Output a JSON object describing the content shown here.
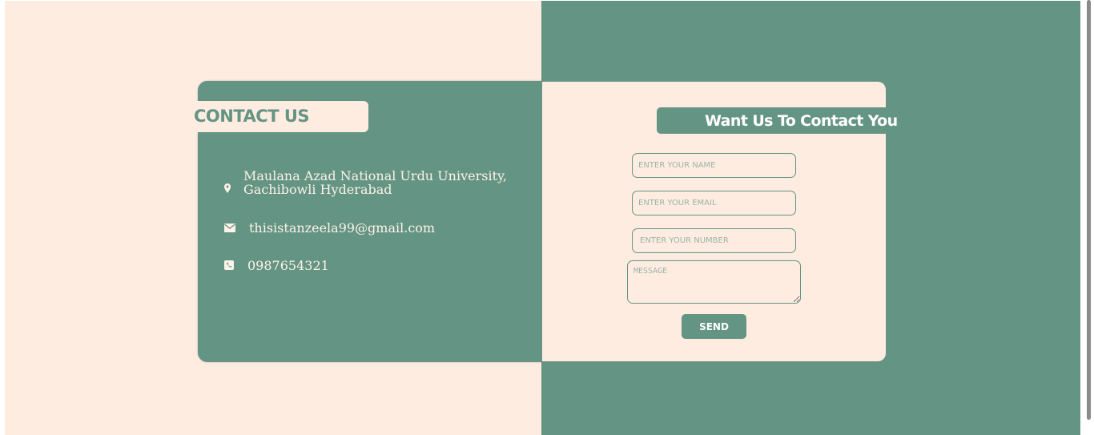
{
  "contact": {
    "title": "CONTACT US",
    "address_line1": "Maulana Azad National Urdu University,",
    "address_line2": "Gachibowli Hyderabad",
    "email": "thisistanzeela99@gmail.com",
    "phone": "0987654321"
  },
  "form": {
    "title": "Want Us To Contact You",
    "name_placeholder": "ENTER YOUR NAME",
    "email_placeholder": "ENTER YOUR EMAIL",
    "number_placeholder": "ENTER YOUR NUMBER",
    "message_placeholder": "MESSAGE",
    "send_label": "SEND"
  },
  "icons": {
    "address": "map-marker-icon",
    "email": "envelope-icon",
    "phone": "phone-square-icon"
  },
  "colors": {
    "primary_green": "#649483",
    "cream": "#feece1",
    "text_light": "#fdf3ea"
  }
}
